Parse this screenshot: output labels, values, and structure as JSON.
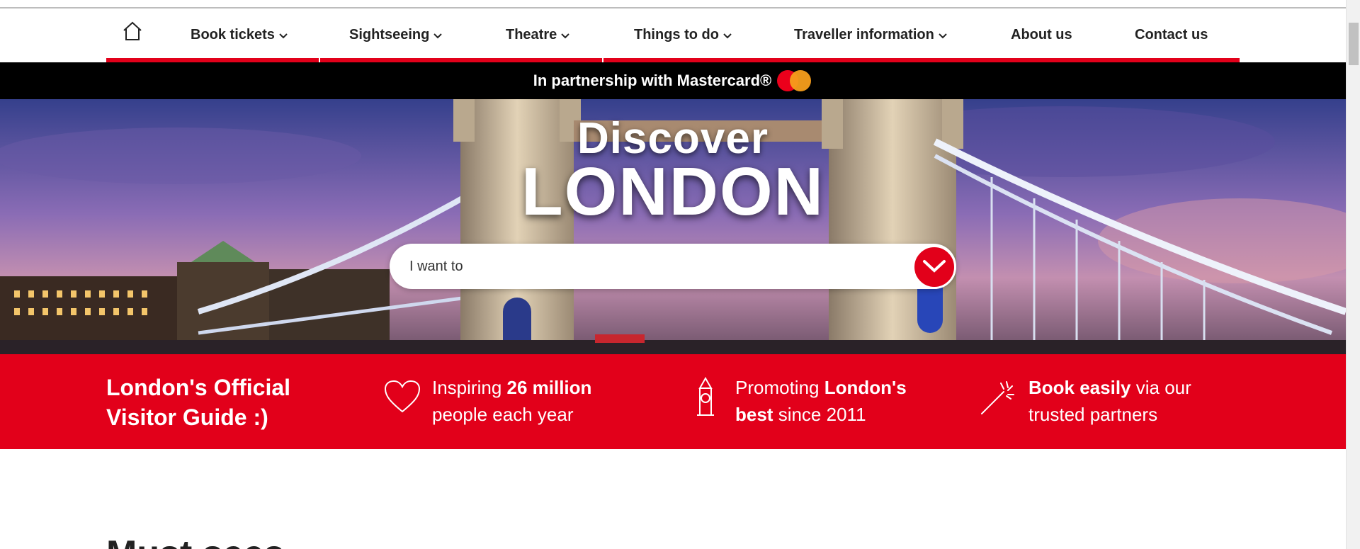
{
  "nav": {
    "home_icon": "home-icon",
    "items": [
      {
        "label": "Book tickets",
        "dropdown": true
      },
      {
        "label": "Sightseeing",
        "dropdown": true
      },
      {
        "label": "Theatre",
        "dropdown": true
      },
      {
        "label": "Things to do",
        "dropdown": true
      },
      {
        "label": "Traveller information",
        "dropdown": true
      },
      {
        "label": "About us",
        "dropdown": false
      },
      {
        "label": "Contact us",
        "dropdown": false
      }
    ],
    "accent_color": "#e2001a"
  },
  "partner_strip": {
    "text": "In partnership with Mastercard®",
    "logo": "mastercard-logo"
  },
  "hero": {
    "title_line1": "Discover",
    "title_line2": "LONDON",
    "search": {
      "placeholder": "I want to",
      "button_icon": "chevron-down-icon"
    }
  },
  "band": {
    "title": "London's Official Visitor Guide :)",
    "items": [
      {
        "icon": "heart-icon",
        "text_before": "Inspiring ",
        "bold": "26 million",
        "text_after": " people each year"
      },
      {
        "icon": "big-ben-icon",
        "text_before": "Promoting ",
        "bold": "London's best",
        "text_after": " since 2011"
      },
      {
        "icon": "magic-wand-icon",
        "text_before": "",
        "bold": "Book easily",
        "text_after": " via our trusted partners"
      }
    ]
  },
  "section": {
    "heading": "Must sees"
  }
}
